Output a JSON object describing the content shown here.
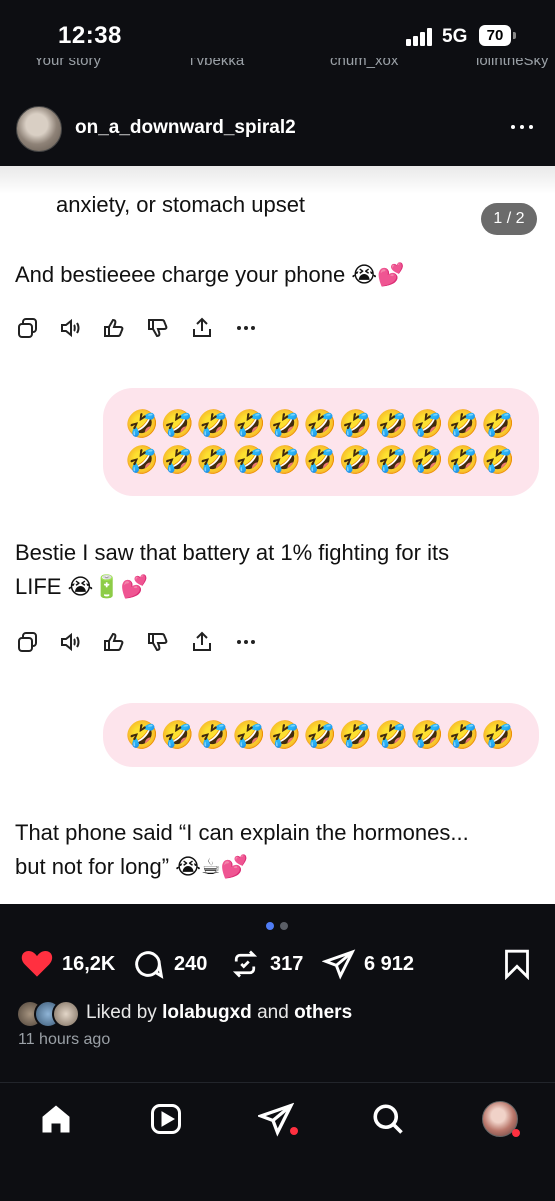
{
  "status_bar": {
    "time": "12:38",
    "network": "5G",
    "battery": "70"
  },
  "stories_row": [
    "Your story",
    "i’vbekka",
    "chum_xox",
    "lolintheSky"
  ],
  "post": {
    "username": "on_a_downward_spiral2",
    "pager": "1 / 2",
    "messages": [
      {
        "role": "assistant",
        "text": "anxiety, or stomach upset"
      },
      {
        "role": "assistant",
        "text": "And bestieeee charge your phone 😭💕"
      },
      {
        "role": "user",
        "line1": "🤣🤣🤣🤣🤣🤣🤣🤣🤣🤣🤣",
        "line2": "🤣🤣🤣🤣🤣🤣🤣🤣🤣🤣🤣"
      },
      {
        "role": "assistant",
        "line1": "Bestie I saw that battery at 1% fighting for its",
        "line2": "LIFE 😭🔋💕"
      },
      {
        "role": "user",
        "text": "🤣🤣🤣🤣🤣🤣🤣🤣🤣🤣🤣"
      },
      {
        "role": "assistant",
        "line1": "That phone said “I can explain the hormones...",
        "line2": "but not for long” 😭☕💕"
      }
    ]
  },
  "carousel": {
    "count": 2,
    "active": 0
  },
  "stats": {
    "likes": "16,2K",
    "comments": "240",
    "reposts": "317",
    "shares": "6 912"
  },
  "liked_by": {
    "prefix": "Liked by",
    "user": "lolabugxd",
    "and": "and",
    "others": "others"
  },
  "timestamp": "11 hours ago",
  "colors": {
    "background": "#0d0e12",
    "bubble": "#fde4ec",
    "heart": "#ff3040",
    "dot_active": "#4f7cf5",
    "notification": "#ff3040"
  },
  "tabs": [
    "home-icon",
    "reels-icon",
    "send-icon",
    "search-icon",
    "profile-avatar"
  ]
}
